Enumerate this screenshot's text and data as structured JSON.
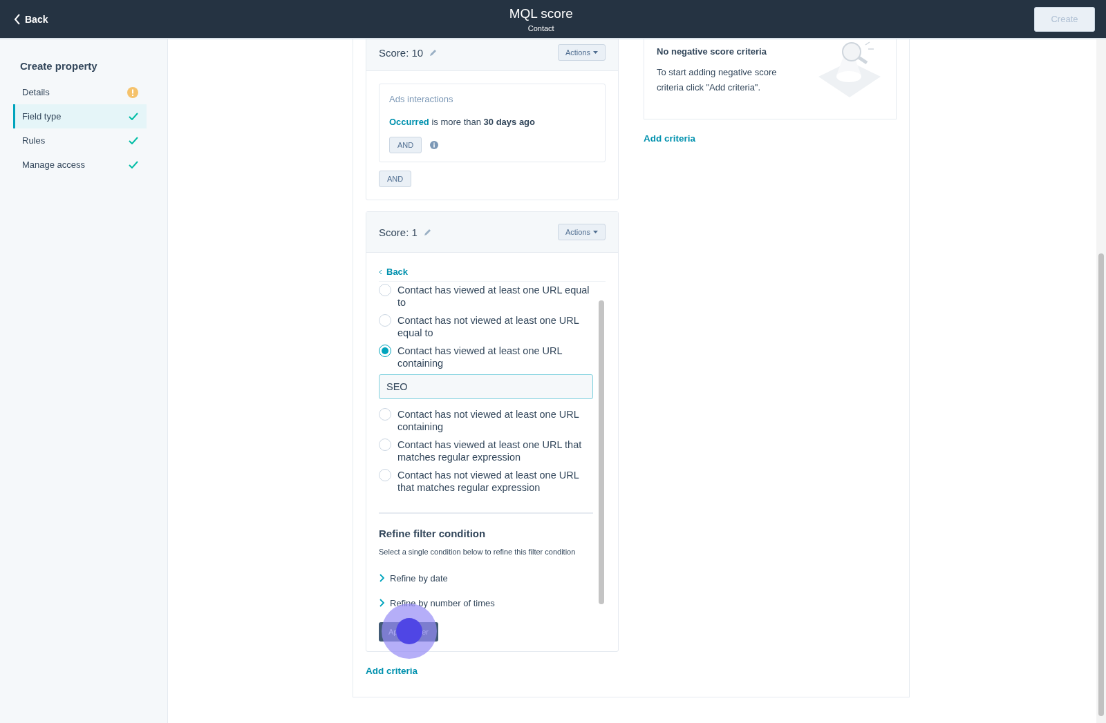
{
  "header": {
    "back": "Back",
    "title": "MQL score",
    "subtitle": "Contact",
    "create": {
      "label": "Create",
      "disabled": true
    }
  },
  "sidebar": {
    "title": "Create property",
    "items": [
      {
        "label": "Details",
        "selected": false,
        "complete": false
      },
      {
        "label": "Field type",
        "selected": true,
        "complete": true
      },
      {
        "label": "Rules",
        "selected": false,
        "complete": true
      },
      {
        "label": "Manage access",
        "selected": false,
        "complete": true
      }
    ]
  },
  "score_groups": [
    {
      "score": "Score: 10",
      "actions": "Actions",
      "filter": {
        "category": "Ads interactions",
        "sentence": "**Occurred** is more than **30 days ago**",
        "and": "AND"
      },
      "and": "AND"
    },
    {
      "score": "Score: 1",
      "actions": "Actions",
      "back": "Back",
      "options": [
        {
          "label": "Contact has viewed at least one URL equal to",
          "selected": false
        },
        {
          "label": "Contact has not viewed at least one URL equal to",
          "selected": false
        },
        {
          "label": "Contact has viewed at least one URL containing",
          "selected": true,
          "value": "SEO"
        },
        {
          "label": "Contact has not viewed at least one URL containing",
          "selected": false
        },
        {
          "label": "Contact has viewed at least one URL that matches regular expression",
          "selected": false
        },
        {
          "label": "Contact has not viewed at least one URL that matches regular expression",
          "selected": false
        }
      ],
      "refine": {
        "title": "Refine filter condition",
        "hint": "Select a single condition below to refine this filter condition",
        "items": [
          {
            "label": "Refine by date",
            "expanded": false
          },
          {
            "label": "Refine by number of times",
            "expanded": false
          }
        ]
      },
      "apply": {
        "visible_parts": [
          "Ap",
          "er"
        ]
      }
    }
  ],
  "add_criteria_left": "Add criteria",
  "negative": {
    "title": "No negative score criteria",
    "text": "To start adding negative score criteria click \"Add criteria\".",
    "add": "Add criteria"
  }
}
